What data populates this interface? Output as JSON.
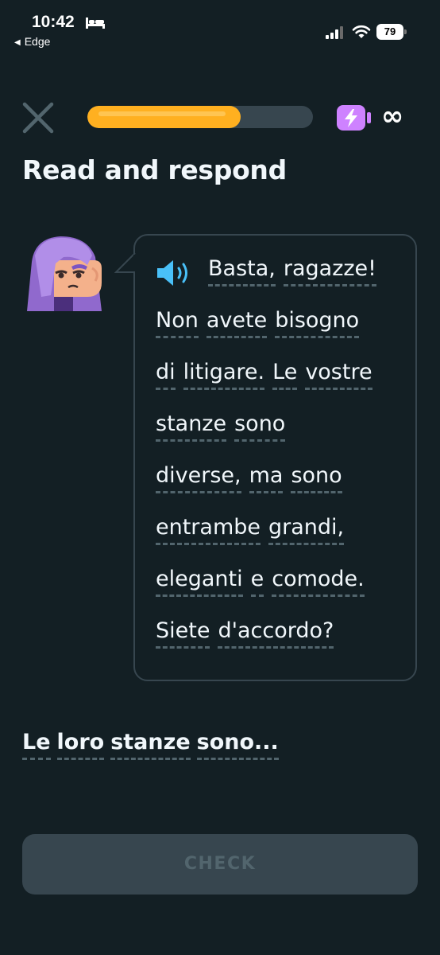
{
  "status_bar": {
    "time": "10:42",
    "back_app": "Edge",
    "battery": "79"
  },
  "lesson": {
    "progress": 0.68,
    "energy": "∞",
    "accent_color": "#ffb020",
    "energy_color": "#ce82ff"
  },
  "title": "Read and respond",
  "passage": {
    "lines": [
      [
        "Basta,",
        "ragazze!"
      ],
      [
        "Non",
        "avete",
        "bisogno"
      ],
      [
        "di",
        "litigare.",
        "Le",
        "vostre"
      ],
      [
        "stanze",
        "sono"
      ],
      [
        "diverse,",
        "ma",
        "sono"
      ],
      [
        "entrambe",
        "grandi,"
      ],
      [
        "eleganti",
        "e",
        "comode."
      ],
      [
        "Siete",
        "d'accordo?"
      ]
    ]
  },
  "question": [
    "Le",
    "loro",
    "stanze",
    "sono..."
  ],
  "check_label": "CHECK"
}
